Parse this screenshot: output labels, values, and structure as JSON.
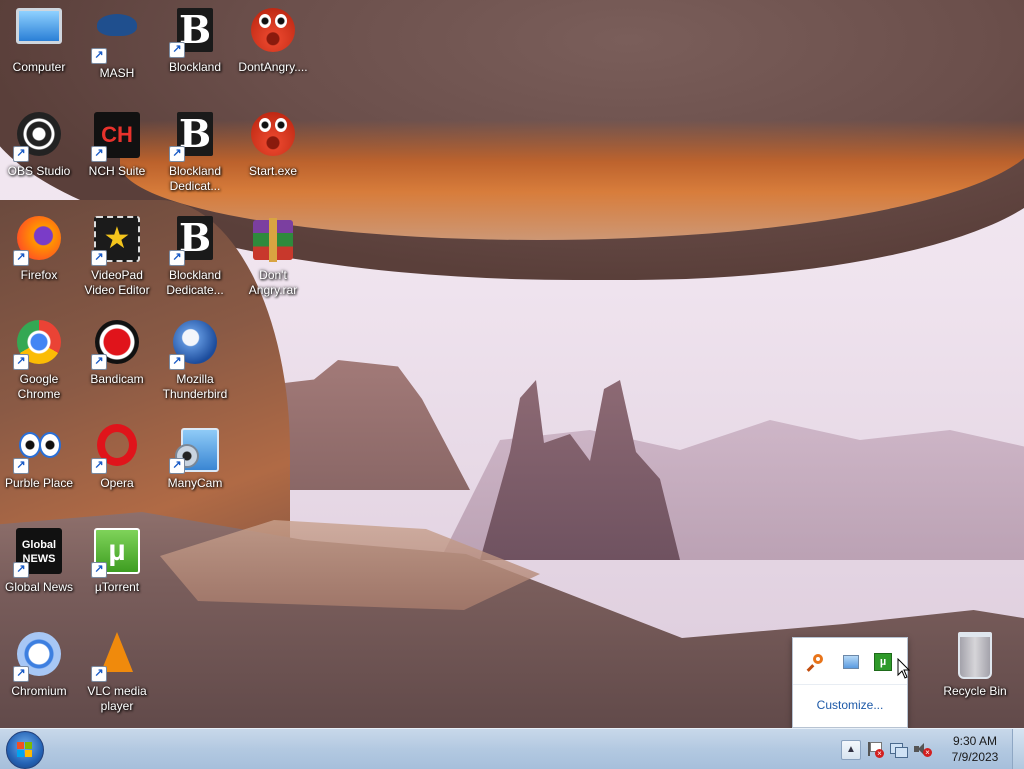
{
  "desktop": {
    "icons": [
      {
        "label": "Computer"
      },
      {
        "label": "MASH"
      },
      {
        "label": "Blockland"
      },
      {
        "label": "DontAngry...."
      },
      {
        "label": "OBS Studio"
      },
      {
        "label": "NCH Suite"
      },
      {
        "label": "Blockland Dedicat..."
      },
      {
        "label": "Start.exe"
      },
      {
        "label": "Firefox"
      },
      {
        "label": "VideoPad Video Editor"
      },
      {
        "label": "Blockland Dedicate..."
      },
      {
        "label": "Don't Angry.rar"
      },
      {
        "label": "Google Chrome"
      },
      {
        "label": "Bandicam"
      },
      {
        "label": "Mozilla Thunderbird"
      },
      {
        "label": "Purble Place"
      },
      {
        "label": "Opera"
      },
      {
        "label": "ManyCam"
      },
      {
        "label": "Global News"
      },
      {
        "label": "µTorrent"
      },
      {
        "label": "Chromium"
      },
      {
        "label": "VLC media player"
      },
      {
        "label": "Recycle Bin"
      }
    ],
    "shortcut_arrow": "↗",
    "blockland_glyph": "B",
    "nch_glyph": "CH",
    "globalnews_glyph": "Global NEWS",
    "utorrent_glyph": "µ",
    "videopad_glyph": "★"
  },
  "tray_popup": {
    "customize_label": "Customize...",
    "icons": [
      "search-tray-icon",
      "network-tray-icon",
      "utorrent-tray-icon"
    ]
  },
  "taskbar": {
    "tray_arrow": "▲",
    "time": "9:30 AM",
    "date": "7/9/2023",
    "tray_icons": [
      "action-center-flag-icon",
      "network-icon",
      "volume-muted-icon"
    ]
  },
  "colors": {
    "taskbar": "#b3c9e1",
    "link": "#1e5aa8"
  }
}
